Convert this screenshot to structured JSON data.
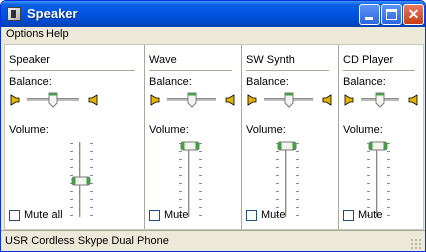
{
  "window": {
    "title": "Speaker"
  },
  "menu": {
    "options": "Options",
    "help": "Help"
  },
  "channels": [
    {
      "name": "Speaker",
      "balance_label": "Balance:",
      "volume_label": "Volume:",
      "mute_label": "Mute all",
      "muted": false,
      "balance": 0.5,
      "volume": 0.45
    },
    {
      "name": "Wave",
      "balance_label": "Balance:",
      "volume_label": "Volume:",
      "mute_label": "Mute",
      "muted": false,
      "balance": 0.5,
      "volume": 0.95
    },
    {
      "name": "SW Synth",
      "balance_label": "Balance:",
      "volume_label": "Volume:",
      "mute_label": "Mute",
      "muted": false,
      "balance": 0.5,
      "volume": 0.95
    },
    {
      "name": "CD Player",
      "balance_label": "Balance:",
      "volume_label": "Volume:",
      "mute_label": "Mute",
      "muted": false,
      "balance": 0.5,
      "volume": 0.95
    }
  ],
  "status": {
    "text": "USR Cordless Skype Dual Phone"
  },
  "colors": {
    "titlebar": "#0054e3",
    "thumb_accent": "#3aa53a",
    "speaker_icon": "#e3b400"
  }
}
